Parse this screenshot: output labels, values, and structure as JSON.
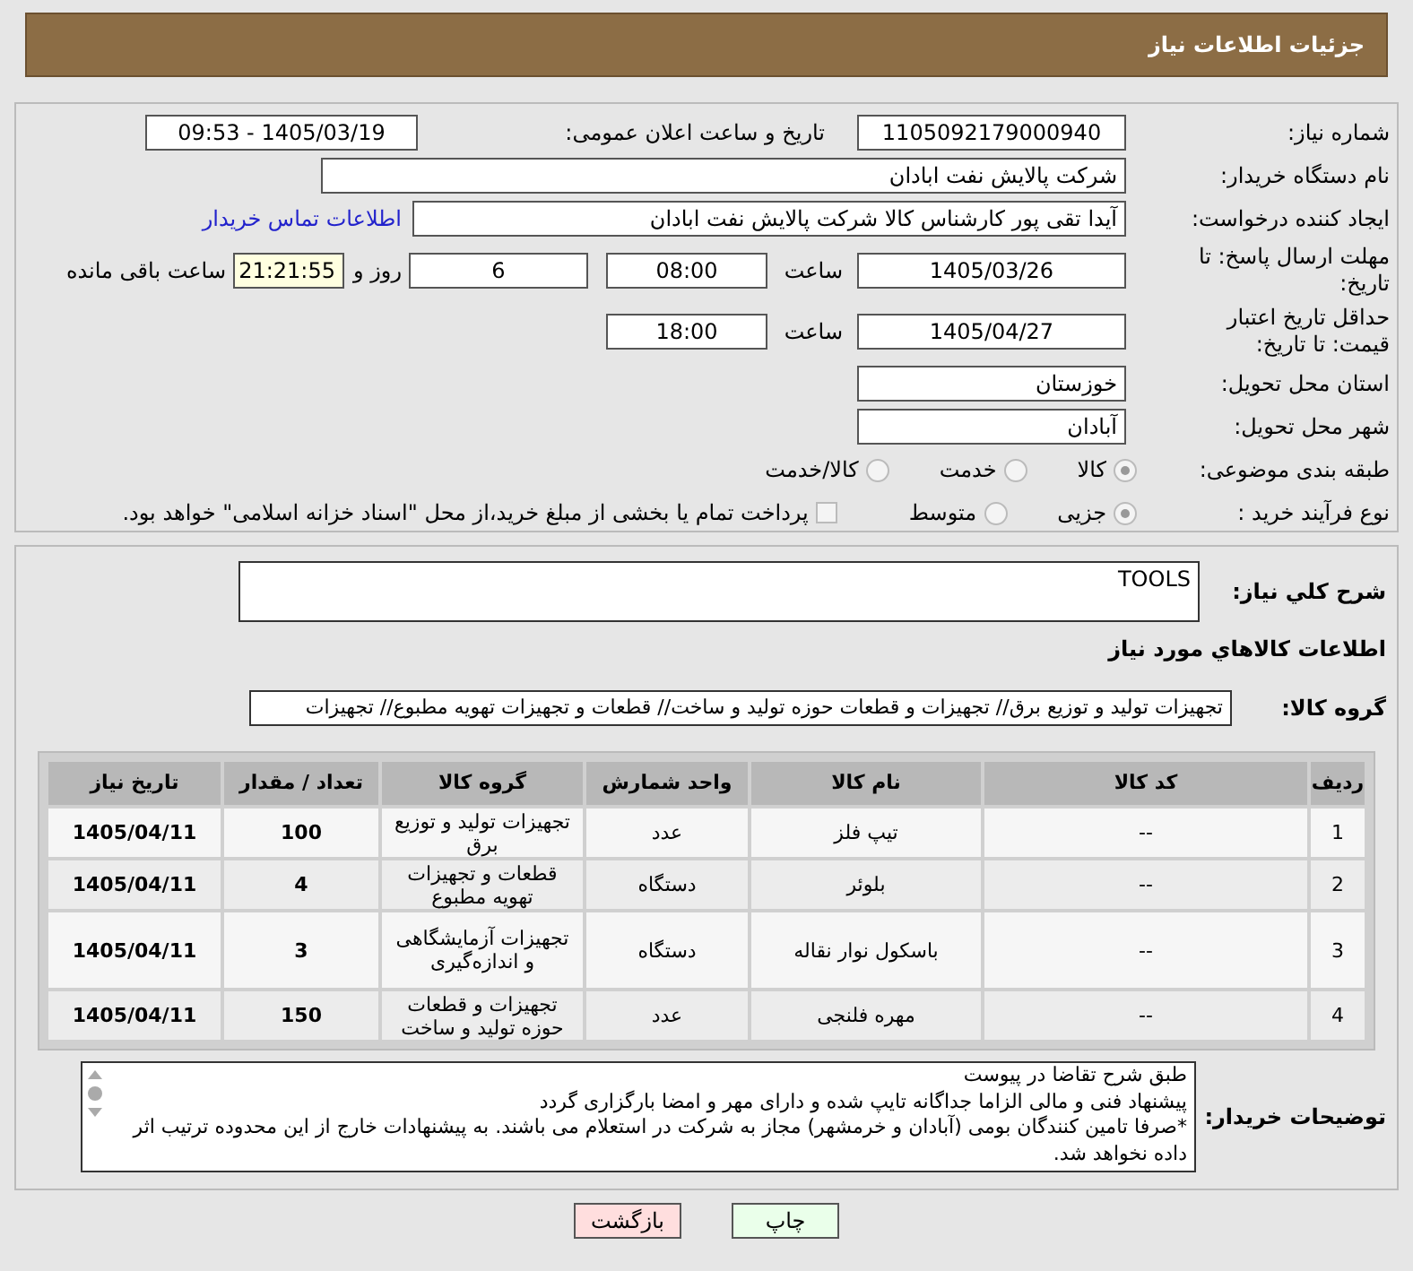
{
  "header": {
    "title": "جزئیات اطلاعات نیاز"
  },
  "need_number": {
    "label": "شماره نیاز:",
    "value": "1105092179000940"
  },
  "announce": {
    "label": "تاریخ و ساعت اعلان عمومی:",
    "value": "1405/03/19 - 09:53"
  },
  "buyer": {
    "label": "نام دستگاه خریدار:",
    "value": "شرکت پالایش نفت ابادان"
  },
  "creator": {
    "label": "ایجاد کننده درخواست:",
    "value": "آیدا تقی پور کارشناس کالا شرکت پالایش نفت ابادان",
    "link": "اطلاعات تماس خریدار"
  },
  "reply_deadline": {
    "label": "مهلت ارسال پاسخ: تا تاریخ:",
    "date": "1405/03/26",
    "time_label": "ساعت",
    "time": "08:00",
    "days": "6",
    "days_label": "روز و",
    "remaining": "21:21:55",
    "remaining_label": "ساعت باقی مانده"
  },
  "price_validity": {
    "label": "حداقل تاریخ اعتبار قیمت: تا تاریخ:",
    "date": "1405/04/27",
    "time_label": "ساعت",
    "time": "18:00"
  },
  "province": {
    "label": "استان محل تحویل:",
    "value": "خوزستان"
  },
  "city": {
    "label": "شهر محل تحویل:",
    "value": "آبادان"
  },
  "category": {
    "label": "طبقه بندی موضوعی:",
    "options": [
      {
        "label": "کالا",
        "selected": true
      },
      {
        "label": "خدمت",
        "selected": false
      },
      {
        "label": "کالا/خدمت",
        "selected": false
      }
    ]
  },
  "process": {
    "label": "نوع فرآیند خرید :",
    "options": [
      {
        "label": "جزیی",
        "selected": true
      },
      {
        "label": "متوسط",
        "selected": false
      }
    ],
    "payment_checked": false,
    "payment_note": "پرداخت تمام یا بخشی از مبلغ خرید،از محل \"اسناد خزانه اسلامی\" خواهد بود."
  },
  "description": {
    "label": "شرح كلي نياز:",
    "value": "TOOLS"
  },
  "goods_title": "اطلاعات كالاهاي مورد نياز",
  "goods_group": {
    "label": "گروه کالا:",
    "value": "تجهیزات تولید و توزیع برق// تجهیزات و قطعات حوزه تولید و ساخت//  قطعات و تجهیزات تهویه مطبوع// تجهیزات"
  },
  "table": {
    "columns": [
      "ردیف",
      "کد کالا",
      "نام کالا",
      "واحد شمارش",
      "گروه کالا",
      "تعداد / مقدار",
      "تاریخ نیاز"
    ],
    "rows": [
      [
        "1",
        "--",
        "تیپ فلز",
        "عدد",
        "تجهیزات تولید و توزیع برق",
        "100",
        "1405/04/11"
      ],
      [
        "2",
        "--",
        "بلوئر",
        "دستگاه",
        "قطعات و تجهیزات تهویه مطبوع",
        "4",
        "1405/04/11"
      ],
      [
        "3",
        "--",
        "باسکول نوار نقاله",
        "دستگاه",
        "تجهیزات آزمایشگاهی و اندازه‌گیری",
        "3",
        "1405/04/11"
      ],
      [
        "4",
        "--",
        "مهره فلنجی",
        "عدد",
        "تجهیزات و قطعات حوزه تولید و ساخت",
        "150",
        "1405/04/11"
      ]
    ]
  },
  "buyer_notes": {
    "label": "توضیحات خریدار:",
    "lines": [
      "طبق شرح تقاضا در پیوست",
      "پیشنهاد فنی و مالی الزاما جداگانه تایپ شده و دارای مهر و امضا بارگزاری گردد",
      "*صرفا تامین کنندگان بومی (آبادان و خرمشهر) مجاز به شرکت در استعلام می باشند. به پیشنهادات خارج از این محدوده ترتیب اثر داده نخواهد شد."
    ]
  },
  "buttons": [
    {
      "kind": "print",
      "label": "چاپ"
    },
    {
      "kind": "back",
      "label": "بازگشت"
    }
  ]
}
